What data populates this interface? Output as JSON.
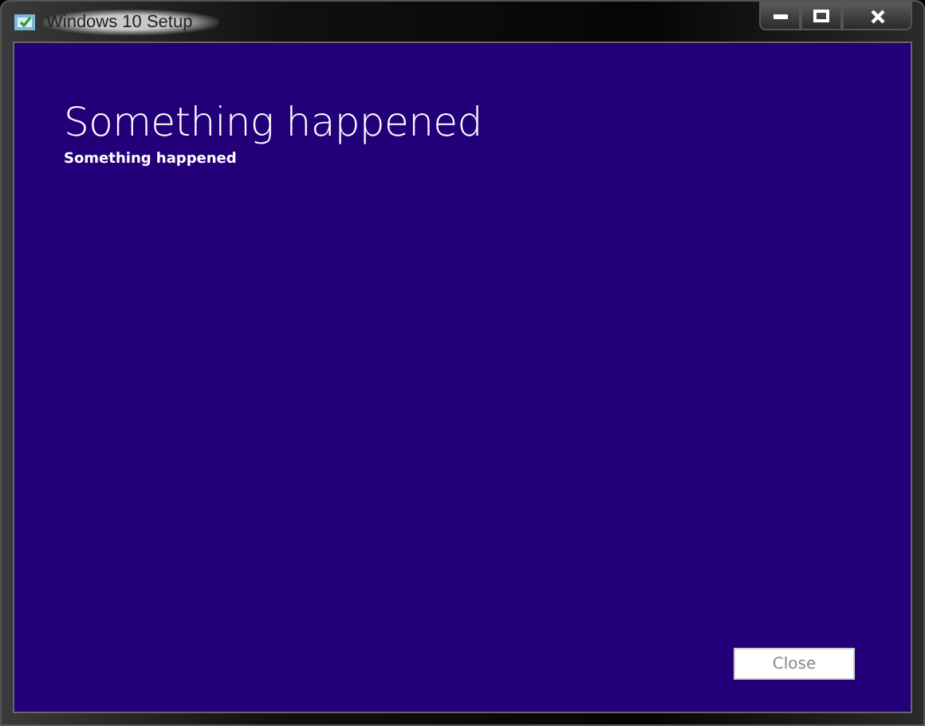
{
  "window": {
    "title": "Windows 10 Setup"
  },
  "heading": "Something happened",
  "message": "Something happened",
  "buttons": [
    {
      "label": "Close"
    }
  ]
}
